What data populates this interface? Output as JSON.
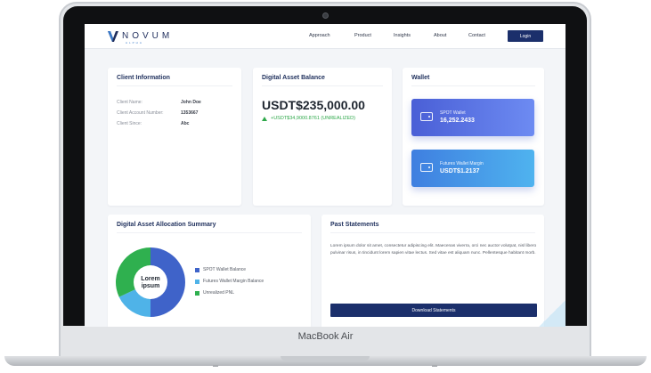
{
  "device": {
    "brand_label": "MacBook Air"
  },
  "header": {
    "logo_text": "NOVUM",
    "logo_sub": "ALPHA",
    "nav": [
      {
        "label": "Approach"
      },
      {
        "label": "Product"
      },
      {
        "label": "Insights"
      },
      {
        "label": "About"
      },
      {
        "label": "Contact"
      }
    ],
    "login_label": "Login"
  },
  "client_info": {
    "title": "Client Information",
    "rows": [
      {
        "label": "Client Name:",
        "value": "John Doe"
      },
      {
        "label": "Client Account Number:",
        "value": "1353667"
      },
      {
        "label": "Client Since:",
        "value": "Abc"
      }
    ]
  },
  "balance": {
    "title": "Digital Asset Balance",
    "amount": "USDT$235,000.00",
    "change": "+USDT$34,9000.8761  (UNREALIZED)"
  },
  "wallet": {
    "title": "Wallet",
    "cards": [
      {
        "name": "SPOT Wallet",
        "value": "16,252.2433",
        "color_from": "#4a5fd6",
        "color_to": "#6d8bf2"
      },
      {
        "name": "Futures Wallet Margin",
        "value": "USDT$1.2137",
        "color_from": "#3f7fe0",
        "color_to": "#4fb3ef"
      }
    ]
  },
  "allocation": {
    "title": "Digital Asset Allocation Summary",
    "center_label": "Lorem ipsum",
    "legend": [
      {
        "label": "SPOT Wallet Balance",
        "color": "#3f63c9"
      },
      {
        "label": "Futures Wallet Margin Balance",
        "color": "#4fb3e8"
      },
      {
        "label": "Unrealized PNL",
        "color": "#2fb04f"
      }
    ]
  },
  "statements": {
    "title": "Past Statements",
    "body": "Lorem ipsum dolor sit amet, consectetur adipiscing elit. Maecenas viverra, orci nec auctor volutpat, nisl libero pulvinar risus, in tincidunt lorem sapien vitae lectus. Sed vitae est aliquam nunc. Pellentesque habitant morb.",
    "button_label": "Download Statements"
  },
  "chart_data": {
    "type": "pie",
    "categories": [
      "SPOT Wallet Balance",
      "Futures Wallet Margin Balance",
      "Unrealized PNL"
    ],
    "values": [
      50,
      18,
      32
    ],
    "colors": [
      "#3f63c9",
      "#4fb3e8",
      "#2fb04f"
    ]
  }
}
